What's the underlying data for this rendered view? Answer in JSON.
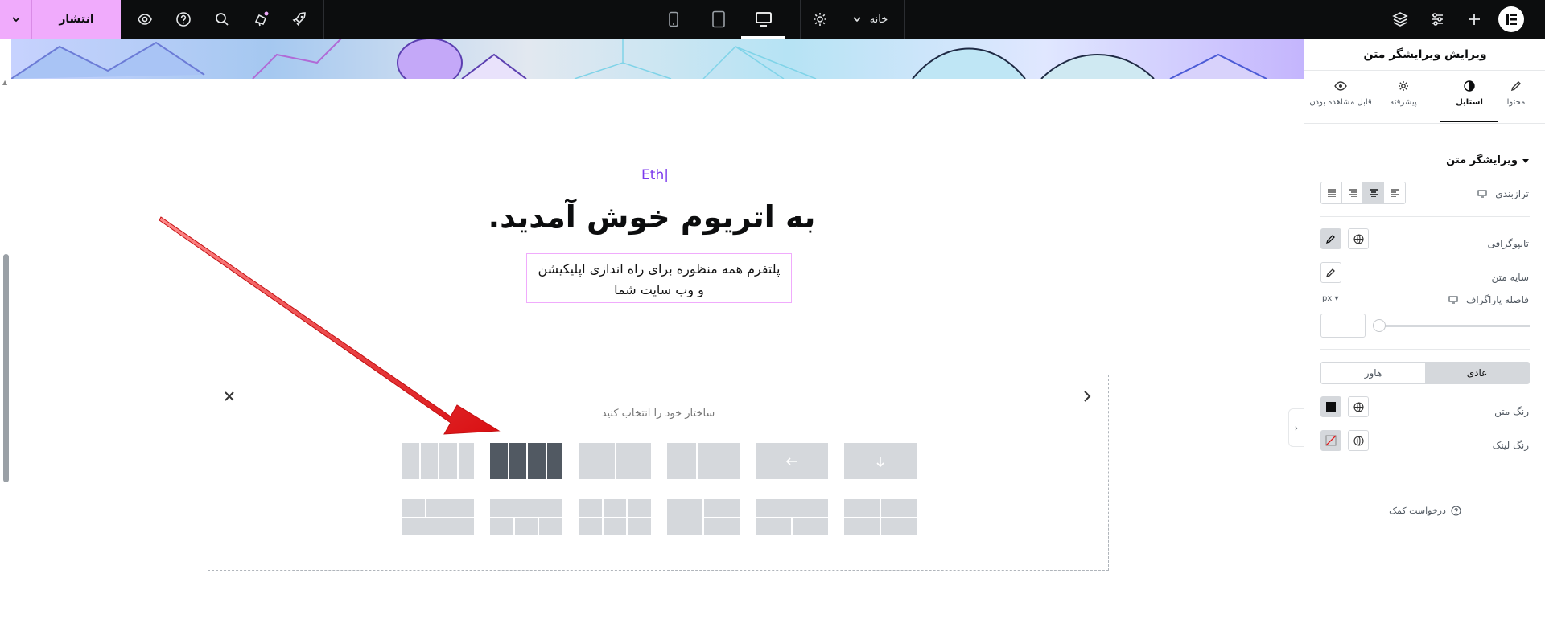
{
  "topbar": {
    "publish_label": "انتشار",
    "page_label": "خانه",
    "icons": [
      "elementor-logo-icon",
      "add-icon",
      "settings-sliders-icon",
      "layers-icon",
      "page-settings-icon",
      "desktop-icon",
      "tablet-icon",
      "mobile-icon",
      "rocket-icon",
      "notifications-icon",
      "search-icon",
      "help-icon",
      "preview-eye-icon",
      "chevron-down-icon"
    ]
  },
  "canvas": {
    "eth_label": "Eth|",
    "hero_title": "به اتریوم خوش آمدید.",
    "hero_subtitle": "پلتفرم همه منظوره برای راه اندازی اپلیکیشن و وب سایت شما",
    "structure_title": "ساختار خود را انتخاب کنید"
  },
  "panel": {
    "title": "ویرایش ویرایشگر متن",
    "tabs": [
      {
        "label": "محتوا",
        "icon": "pencil-icon"
      },
      {
        "label": "استایل",
        "icon": "half-circle-icon"
      },
      {
        "label": "پیشرفته",
        "icon": "gear-icon"
      },
      {
        "label": "قابل مشاهده بودن",
        "icon": "eye-icon"
      }
    ],
    "active_tab": "استایل",
    "section_title": "ویرایشگر متن",
    "alignment_label": "ترازبندی",
    "typography_label": "تایپوگرافی",
    "text_shadow_label": "سایه متن",
    "paragraph_spacing_label": "فاصله پاراگراف",
    "unit": "px",
    "paragraph_spacing_value": "",
    "state_normal": "عادی",
    "state_hover": "هاور",
    "text_color_label": "رنگ متن",
    "link_color_label": "رنگ لینک",
    "help_label": "درخواست کمک"
  },
  "colors": {
    "accent": "#f0abfc",
    "topbar": "#0c0d0e",
    "eth": "#7c3aed",
    "arrow": "#e3191b"
  }
}
